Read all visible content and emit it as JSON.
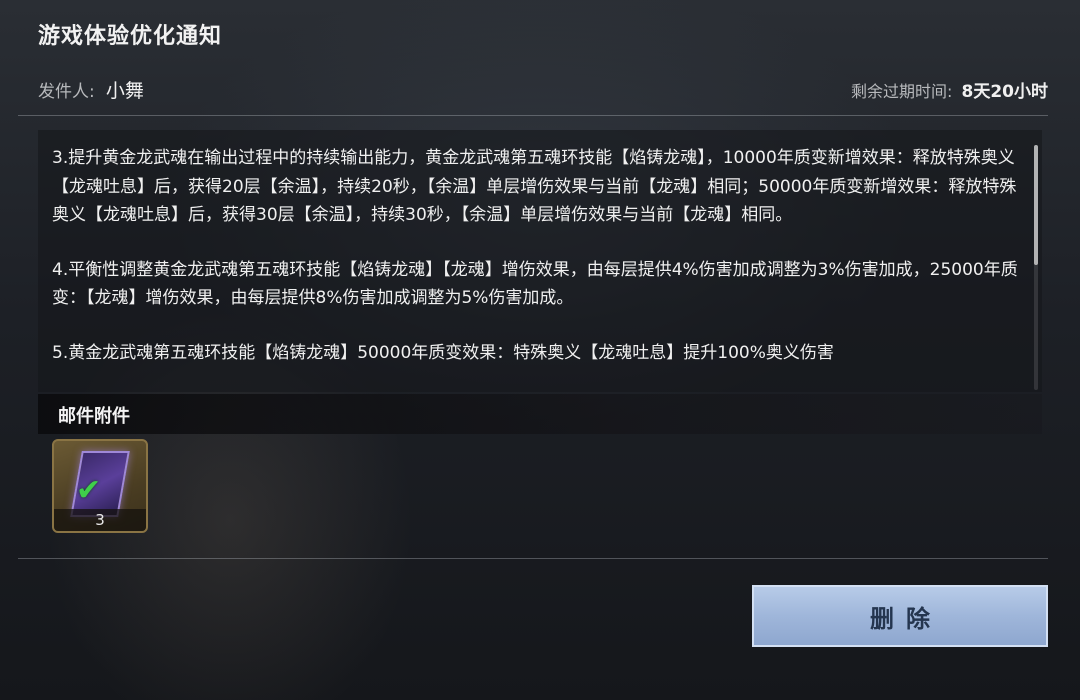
{
  "mail": {
    "title": "游戏体验优化通知",
    "sender_label": "发件人:",
    "sender_name": "小舞",
    "expire_label": "剩余过期时间:",
    "expire_value": "8天20小时"
  },
  "content": {
    "paragraphs": [
      "3.提升黄金龙武魂在输出过程中的持续输出能力，黄金龙武魂第五魂环技能【焰铸龙魂】，10000年质变新增效果：释放特殊奥义【龙魂吐息】后，获得20层【余温】，持续20秒，【余温】单层增伤效果与当前【龙魂】相同；50000年质变新增效果：释放特殊奥义【龙魂吐息】后，获得30层【余温】，持续30秒，【余温】单层增伤效果与当前【龙魂】相同。",
      "4.平衡性调整黄金龙武魂第五魂环技能【焰铸龙魂】【龙魂】增伤效果，由每层提供4%伤害加成调整为3%伤害加成，25000年质变：【龙魂】增伤效果，由每层提供8%伤害加成调整为5%伤害加成。",
      "5.黄金龙武魂第五魂环技能【焰铸龙魂】50000年质变效果：特殊奥义【龙魂吐息】提升100%奥义伤害"
    ]
  },
  "attachments": {
    "title": "邮件附件",
    "items": [
      {
        "icon": "purple-card-icon",
        "claimed_icon": "check-icon",
        "count": "3"
      }
    ]
  },
  "actions": {
    "delete_label": "删除"
  },
  "colors": {
    "button_bg": "#9fb6da",
    "button_text": "#24354f",
    "check": "#3fd04a"
  }
}
